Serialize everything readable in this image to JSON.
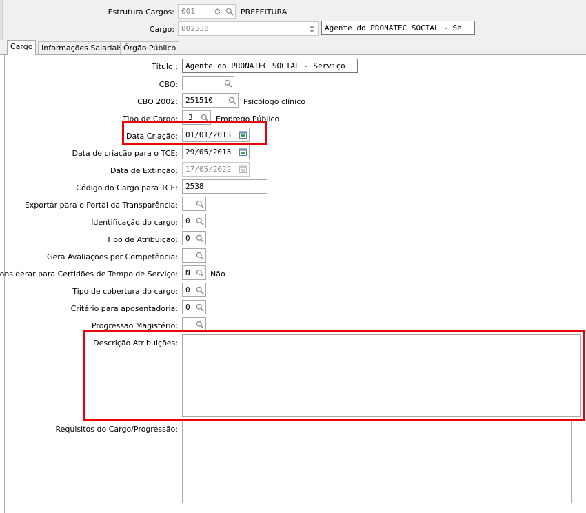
{
  "header": {
    "estrutura_label": "Estrutura Cargos:",
    "estrutura_value": "001",
    "estrutura_desc": "PREFEITURA",
    "cargo_label": "Cargo:",
    "cargo_value": "002538",
    "cargo_desc": "Agente do PRONATEC SOCIAL - Se"
  },
  "tabs": [
    {
      "label": "Cargo",
      "active": true
    },
    {
      "label": "Informações Salariais",
      "active": false
    },
    {
      "label": "Órgão Público",
      "active": false
    }
  ],
  "form": {
    "titulo_label": "Título :",
    "titulo_value": "Agente do PRONATEC SOCIAL - Serviço",
    "cbo_label": "CBO:",
    "cbo_value": "",
    "cbo2002_label": "CBO 2002:",
    "cbo2002_value": "251510",
    "cbo2002_desc": "Psicólogo clínico",
    "tipo_cargo_label": "Tipo de Cargo:",
    "tipo_cargo_value": "3",
    "tipo_cargo_desc": "Emprego Público",
    "data_criacao_label": "Data Criação:",
    "data_criacao_value": "01/01/2013",
    "data_tce_label": "Data de criação para o TCE:",
    "data_tce_value": "29/05/2013",
    "data_extincao_label": "Data de Extinção:",
    "data_extincao_value": "17/05/2022",
    "codigo_tce_label": "Código do Cargo para TCE:",
    "codigo_tce_value": "2538",
    "exportar_label": "Exportar para o Portal da Transparência:",
    "exportar_value": "",
    "identificacao_label": "Identificação do cargo:",
    "identificacao_value": "0",
    "tipo_atribuicao_label": "Tipo de Atribuição:",
    "tipo_atribuicao_value": "0",
    "gera_avaliacoes_label": "Gera Avaliações por Competência:",
    "gera_avaliacoes_value": "",
    "considerar_label": "Considerar para Certidões de Tempo de Serviço:",
    "considerar_value": "N",
    "considerar_desc": "Não",
    "tipo_cobertura_label": "Tipo de cobertura do cargo:",
    "tipo_cobertura_value": "0",
    "criterio_label": "Critério para aposentadoria:",
    "criterio_value": "0",
    "progressao_label": "Progressão Magistério:",
    "progressao_value": "",
    "descricao_label": "Descrição Atribuições:",
    "requisitos_label": "Requisitos do Cargo/Progressão:"
  },
  "icons": {
    "search": "magnifier-icon",
    "calendar": "calendar-icon",
    "spin": "spin-arrows-icon",
    "dropdown": "chevron-down-icon"
  },
  "colors": {
    "highlight": "#e8000b",
    "panel": "#f0f0f0",
    "border": "#a9a9a9"
  }
}
